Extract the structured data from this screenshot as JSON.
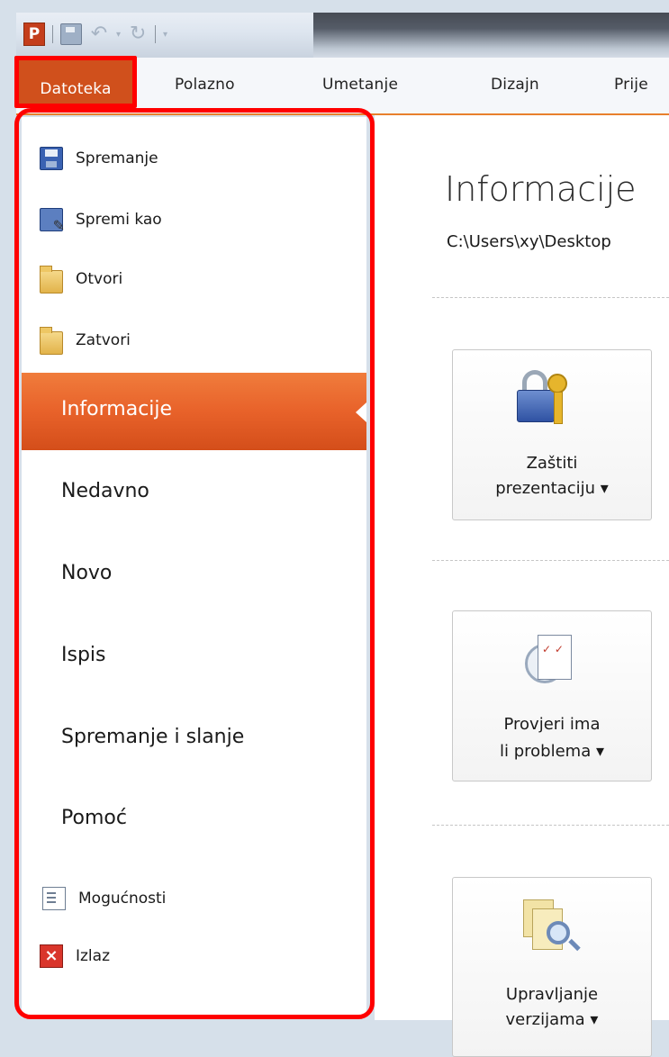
{
  "quick_access": {
    "app_icon": "powerpoint-icon",
    "app_icon_letter": "P",
    "items": [
      "save-icon",
      "undo-icon",
      "redo-icon",
      "customize-icon"
    ]
  },
  "ribbon": {
    "tabs": [
      "Datoteka",
      "Polazno",
      "Umetanje",
      "Dizajn",
      "Prije"
    ],
    "active_tab": "Datoteka",
    "accent_color": "#d0501c"
  },
  "backstage": {
    "commands": [
      {
        "label": "Spremanje",
        "icon": "floppy-icon"
      },
      {
        "label": "Spremi kao",
        "icon": "save-as-icon"
      },
      {
        "label": "Otvori",
        "icon": "open-folder-icon"
      },
      {
        "label": "Zatvori",
        "icon": "close-folder-icon"
      }
    ],
    "tabs": [
      "Informacije",
      "Nedavno",
      "Novo",
      "Ispis",
      "Spremanje i slanje",
      "Pomoć"
    ],
    "active_tab": "Informacije",
    "bottom_commands": [
      {
        "label": "Mogućnosti",
        "icon": "options-icon"
      },
      {
        "label": "Izlaz",
        "icon": "exit-icon"
      }
    ],
    "highlight_color": "#ff0000"
  },
  "content": {
    "title": "Informacije",
    "path": "C:\\Users\\xy\\Desktop",
    "buttons": [
      {
        "line1": "Zaštiti",
        "line2": "prezentaciju ▾",
        "icon": "lock-key-icon"
      },
      {
        "line1": "Provjeri ima",
        "line2": "li problema ▾",
        "icon": "check-document-icon"
      },
      {
        "line1": "Upravljanje",
        "line2": "verzijama ▾",
        "icon": "versions-icon"
      }
    ]
  }
}
